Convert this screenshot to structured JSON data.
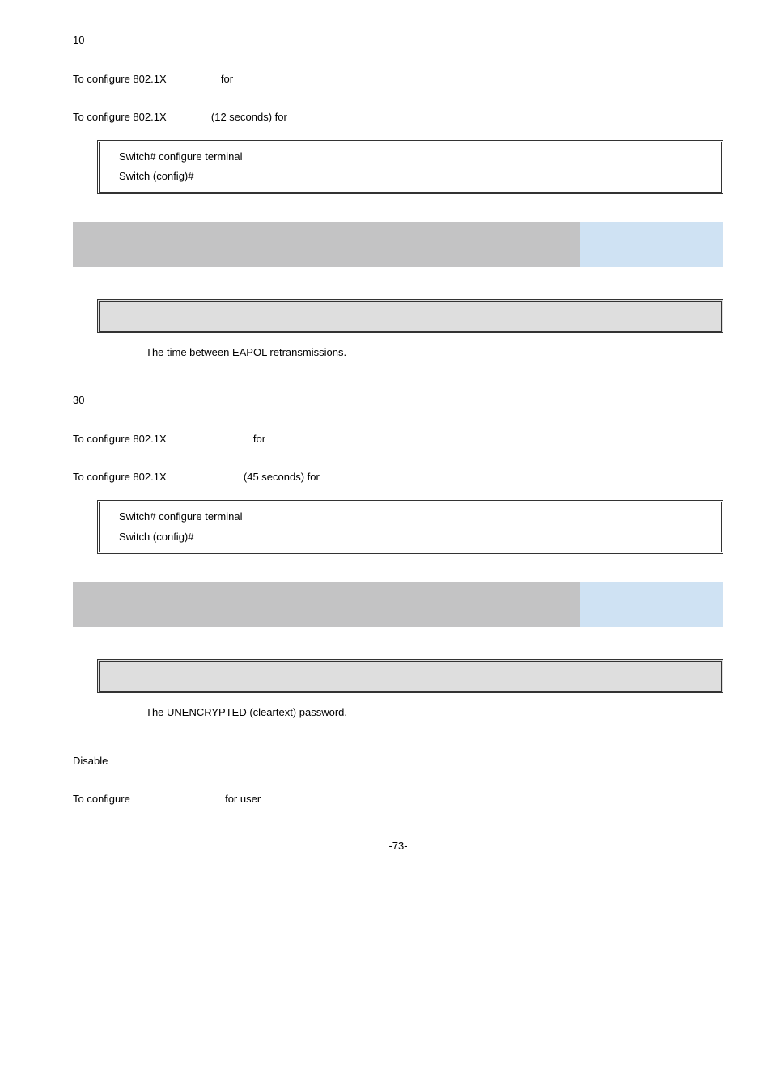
{
  "block1": {
    "line1": "10",
    "line2_a": "To configure 802.1X",
    "line2_b": "for",
    "line3_a": "To configure 802.1X",
    "line3_b": "(12 seconds) for",
    "code_l1": "Switch# configure terminal",
    "code_l2": "Switch (config)#"
  },
  "block2": {
    "desc": "The time between EAPOL retransmissions.",
    "line1": "30",
    "line2_a": "To configure 802.1X",
    "line2_b": "for",
    "line3_a": "To configure 802.1X",
    "line3_b": "(45 seconds) for",
    "code_l1": "Switch# configure terminal",
    "code_l2": "Switch (config)#"
  },
  "block3": {
    "desc": "The UNENCRYPTED (cleartext) password.",
    "line1": "Disable",
    "line2_a": "To configure",
    "line2_b": "for user"
  },
  "page_number": "-73-"
}
